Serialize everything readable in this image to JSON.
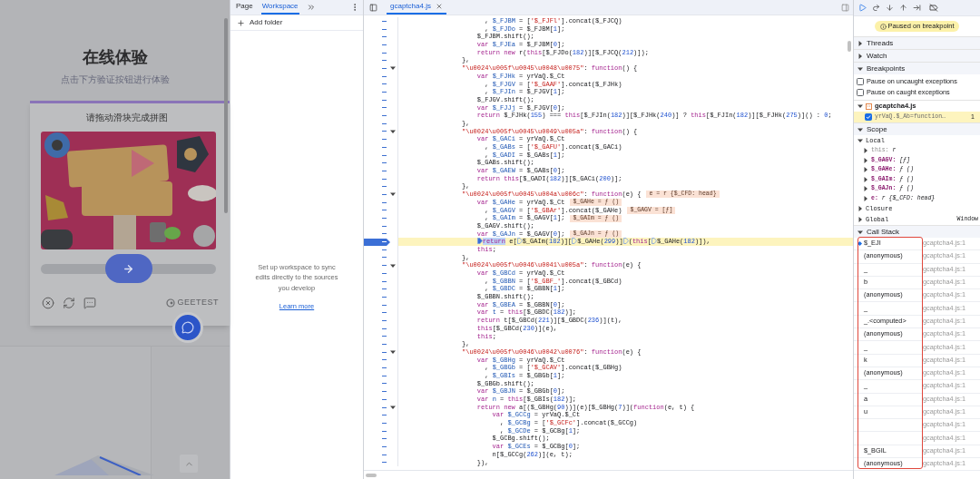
{
  "page": {
    "title": "在线体验",
    "subtitle": "点击下方验证按钮进行体验",
    "captcha": {
      "prompt": "请拖动滑块完成拼图",
      "slider": {
        "level": 0.5
      },
      "brand": "GEETEST"
    }
  },
  "navigator": {
    "tabs": [
      {
        "label": "Page",
        "selected": false
      },
      {
        "label": "Workspace",
        "selected": true
      }
    ],
    "add_folder": "Add folder",
    "message": "Set up workspace to sync edits directly to the sources you develop",
    "link": "Learn more"
  },
  "editor": {
    "tabs": [
      {
        "label": "gcaptcha4.js",
        "selected": true
      }
    ],
    "lines": [
      {
        "tokens": [
          {
            "kind": "p",
            "text": "      , "
          },
          {
            "kind": "d",
            "text": "$_FJBM"
          },
          {
            "kind": "p",
            "text": " = ["
          },
          {
            "kind": "s",
            "text": "'$_FJFl'"
          },
          {
            "kind": "p",
            "text": "].concat($_FJCQ)"
          }
        ]
      },
      {
        "tokens": [
          {
            "kind": "p",
            "text": "      , "
          },
          {
            "kind": "d",
            "text": "$_FJDo"
          },
          {
            "kind": "p",
            "text": " = $_FJBM["
          },
          {
            "kind": "n",
            "text": "1"
          },
          {
            "kind": "p",
            "text": "];"
          }
        ]
      },
      {
        "tokens": [
          {
            "kind": "p",
            "text": "    $_FJBM.shift();"
          }
        ]
      },
      {
        "tokens": [
          {
            "kind": "k",
            "text": "    var"
          },
          {
            "kind": "d",
            "text": " $_FJEa"
          },
          {
            "kind": "p",
            "text": " = $_FJBM["
          },
          {
            "kind": "n",
            "text": "0"
          },
          {
            "kind": "p",
            "text": "];"
          }
        ]
      },
      {
        "tokens": [
          {
            "kind": "k",
            "text": "    return new"
          },
          {
            "kind": "p",
            "text": " r("
          },
          {
            "kind": "k",
            "text": "this"
          },
          {
            "kind": "p",
            "text": "[$_FJDo("
          },
          {
            "kind": "n",
            "text": "182"
          },
          {
            "kind": "p",
            "text": ")][$_FJCQ("
          },
          {
            "kind": "n",
            "text": "212"
          },
          {
            "kind": "p",
            "text": ")]);"
          }
        ]
      },
      {
        "tokens": [
          {
            "kind": "p",
            "text": "},"
          }
        ]
      },
      {
        "expanded": true,
        "tokens": [
          {
            "kind": "s",
            "text": "\"\\u0024\\u005f\\u0045\\u0048\\u0075\""
          },
          {
            "kind": "p",
            "text": ": "
          },
          {
            "kind": "k",
            "text": "function"
          },
          {
            "kind": "p",
            "text": "() {"
          }
        ]
      },
      {
        "tokens": [
          {
            "kind": "k",
            "text": "    var"
          },
          {
            "kind": "d",
            "text": " $_FJHk"
          },
          {
            "kind": "p",
            "text": " = yrVaQ.$_Ct"
          }
        ]
      },
      {
        "tokens": [
          {
            "kind": "p",
            "text": "      , "
          },
          {
            "kind": "d",
            "text": "$_FJGV"
          },
          {
            "kind": "p",
            "text": " = ["
          },
          {
            "kind": "s",
            "text": "'$_GAAF'"
          },
          {
            "kind": "p",
            "text": "].concat($_FJHk)"
          }
        ]
      },
      {
        "tokens": [
          {
            "kind": "p",
            "text": "      , "
          },
          {
            "kind": "d",
            "text": "$_FJIn"
          },
          {
            "kind": "p",
            "text": " = $_FJGV["
          },
          {
            "kind": "n",
            "text": "1"
          },
          {
            "kind": "p",
            "text": "];"
          }
        ]
      },
      {
        "tokens": [
          {
            "kind": "p",
            "text": "    $_FJGV.shift();"
          }
        ]
      },
      {
        "tokens": [
          {
            "kind": "k",
            "text": "    var"
          },
          {
            "kind": "d",
            "text": " $_FJJj"
          },
          {
            "kind": "p",
            "text": " = $_FJGV["
          },
          {
            "kind": "n",
            "text": "0"
          },
          {
            "kind": "p",
            "text": "];"
          }
        ]
      },
      {
        "tokens": [
          {
            "kind": "k",
            "text": "    return"
          },
          {
            "kind": "p",
            "text": " $_FJHk("
          },
          {
            "kind": "n",
            "text": "155"
          },
          {
            "kind": "p",
            "text": ") === "
          },
          {
            "kind": "k",
            "text": "this"
          },
          {
            "kind": "p",
            "text": "[$_FJIn("
          },
          {
            "kind": "n",
            "text": "182"
          },
          {
            "kind": "p",
            "text": ")][$_FJHk("
          },
          {
            "kind": "n",
            "text": "240"
          },
          {
            "kind": "p",
            "text": ")] ? "
          },
          {
            "kind": "k",
            "text": "this"
          },
          {
            "kind": "p",
            "text": "[$_FJIn("
          },
          {
            "kind": "n",
            "text": "182"
          },
          {
            "kind": "p",
            "text": ")][$_FJHk("
          },
          {
            "kind": "n",
            "text": "275"
          },
          {
            "kind": "p",
            "text": ")]() : "
          },
          {
            "kind": "n",
            "text": "0"
          },
          {
            "kind": "p",
            "text": ";"
          }
        ]
      },
      {
        "tokens": [
          {
            "kind": "p",
            "text": "},"
          }
        ]
      },
      {
        "expanded": true,
        "tokens": [
          {
            "kind": "s",
            "text": "\"\\u0024\\u005f\\u0045\\u0049\\u005a\""
          },
          {
            "kind": "p",
            "text": ": "
          },
          {
            "kind": "k",
            "text": "function"
          },
          {
            "kind": "p",
            "text": "() {"
          }
        ]
      },
      {
        "tokens": [
          {
            "kind": "k",
            "text": "    var"
          },
          {
            "kind": "d",
            "text": " $_GACi"
          },
          {
            "kind": "p",
            "text": " = yrVaQ.$_Ct"
          }
        ]
      },
      {
        "tokens": [
          {
            "kind": "p",
            "text": "      , "
          },
          {
            "kind": "d",
            "text": "$_GABs"
          },
          {
            "kind": "p",
            "text": " = ["
          },
          {
            "kind": "s",
            "text": "'$_GAFU'"
          },
          {
            "kind": "p",
            "text": "].concat($_GACi)"
          }
        ]
      },
      {
        "tokens": [
          {
            "kind": "p",
            "text": "      , "
          },
          {
            "kind": "d",
            "text": "$_GADI"
          },
          {
            "kind": "p",
            "text": " = $_GABs["
          },
          {
            "kind": "n",
            "text": "1"
          },
          {
            "kind": "p",
            "text": "];"
          }
        ]
      },
      {
        "tokens": [
          {
            "kind": "p",
            "text": "    $_GABs.shift();"
          }
        ]
      },
      {
        "tokens": [
          {
            "kind": "k",
            "text": "    var"
          },
          {
            "kind": "d",
            "text": " $_GAEW"
          },
          {
            "kind": "p",
            "text": " = $_GABs["
          },
          {
            "kind": "n",
            "text": "0"
          },
          {
            "kind": "p",
            "text": "];"
          }
        ]
      },
      {
        "tokens": [
          {
            "kind": "k",
            "text": "    return this"
          },
          {
            "kind": "p",
            "text": "[$_GADI("
          },
          {
            "kind": "n",
            "text": "182"
          },
          {
            "kind": "p",
            "text": ")][$_GACi("
          },
          {
            "kind": "n",
            "text": "200"
          },
          {
            "kind": "p",
            "text": ")];"
          }
        ]
      },
      {
        "tokens": [
          {
            "kind": "p",
            "text": "},"
          }
        ]
      },
      {
        "expanded": true,
        "inline": "e = r {$_CFD: head}",
        "tokens": [
          {
            "kind": "s",
            "text": "\"\\u0024\\u005f\\u0045\\u004a\\u006c\""
          },
          {
            "kind": "p",
            "text": ": "
          },
          {
            "kind": "k",
            "text": "function"
          },
          {
            "kind": "p",
            "text": "(e) {"
          }
        ]
      },
      {
        "inline": "$_GAHe = ƒ ()",
        "tokens": [
          {
            "kind": "k",
            "text": "    var"
          },
          {
            "kind": "d",
            "text": " $_GAHe"
          },
          {
            "kind": "p",
            "text": " = yrVaQ.$_Ct"
          }
        ]
      },
      {
        "inline": "$_GAGV = [ƒ]",
        "tokens": [
          {
            "kind": "p",
            "text": "      , "
          },
          {
            "kind": "d",
            "text": "$_GAGV"
          },
          {
            "kind": "p",
            "text": " = ["
          },
          {
            "kind": "s",
            "text": "'$_GBAr'"
          },
          {
            "kind": "p",
            "text": "].concat($_GAHe)"
          }
        ]
      },
      {
        "inline": "$_GAIm = ƒ ()",
        "tokens": [
          {
            "kind": "p",
            "text": "      , "
          },
          {
            "kind": "d",
            "text": "$_GAIm"
          },
          {
            "kind": "p",
            "text": " = $_GAGV["
          },
          {
            "kind": "n",
            "text": "1"
          },
          {
            "kind": "p",
            "text": "];"
          }
        ]
      },
      {
        "tokens": [
          {
            "kind": "p",
            "text": "    $_GAGV.shift();"
          }
        ]
      },
      {
        "inline": "$_GAJn = ƒ ()",
        "tokens": [
          {
            "kind": "k",
            "text": "    var"
          },
          {
            "kind": "d",
            "text": " $_GAJn"
          },
          {
            "kind": "p",
            "text": " = $_GAGV["
          },
          {
            "kind": "n",
            "text": "0"
          },
          {
            "kind": "p",
            "text": "];"
          }
        ]
      },
      {
        "paused": true,
        "tokens": [
          {
            "kind": "c",
            "text": "    return"
          },
          {
            "kind": "p",
            "text": " e["
          },
          {
            "kind": "step"
          },
          {
            "kind": "p",
            "text": "$_GAIm("
          },
          {
            "kind": "n",
            "text": "182"
          },
          {
            "kind": "p",
            "text": ")]["
          },
          {
            "kind": "step"
          },
          {
            "kind": "p",
            "text": "$_GAHe("
          },
          {
            "kind": "n",
            "text": "299"
          },
          {
            "kind": "p",
            "text": ")]"
          },
          {
            "kind": "step"
          },
          {
            "kind": "p",
            "text": "("
          },
          {
            "kind": "k",
            "text": "this"
          },
          {
            "kind": "p",
            "text": "["
          },
          {
            "kind": "step"
          },
          {
            "kind": "p",
            "text": "$_GAHe("
          },
          {
            "kind": "n",
            "text": "182"
          },
          {
            "kind": "p",
            "text": ")]),"
          }
        ]
      },
      {
        "tokens": [
          {
            "kind": "k",
            "text": "    this"
          },
          {
            "kind": "p",
            "text": ";"
          }
        ]
      },
      {
        "tokens": [
          {
            "kind": "p",
            "text": "},"
          }
        ]
      },
      {
        "expanded": true,
        "tokens": [
          {
            "kind": "s",
            "text": "\"\\u0024\\u005f\\u0046\\u0041\\u005a\""
          },
          {
            "kind": "p",
            "text": ": "
          },
          {
            "kind": "k",
            "text": "function"
          },
          {
            "kind": "p",
            "text": "(e) {"
          }
        ]
      },
      {
        "tokens": [
          {
            "kind": "k",
            "text": "    var"
          },
          {
            "kind": "d",
            "text": " $_GBCd"
          },
          {
            "kind": "p",
            "text": " = yrVaQ.$_Ct"
          }
        ]
      },
      {
        "tokens": [
          {
            "kind": "p",
            "text": "      , "
          },
          {
            "kind": "d",
            "text": "$_GBBN"
          },
          {
            "kind": "p",
            "text": " = ["
          },
          {
            "kind": "s",
            "text": "'$_GBF_'"
          },
          {
            "kind": "p",
            "text": "].concat($_GBCd)"
          }
        ]
      },
      {
        "tokens": [
          {
            "kind": "p",
            "text": "      , "
          },
          {
            "kind": "d",
            "text": "$_GBDC"
          },
          {
            "kind": "p",
            "text": " = $_GBBN["
          },
          {
            "kind": "n",
            "text": "1"
          },
          {
            "kind": "p",
            "text": "];"
          }
        ]
      },
      {
        "tokens": [
          {
            "kind": "p",
            "text": "    $_GBBN.shift();"
          }
        ]
      },
      {
        "tokens": [
          {
            "kind": "k",
            "text": "    var"
          },
          {
            "kind": "d",
            "text": " $_GBEA"
          },
          {
            "kind": "p",
            "text": " = $_GBBN["
          },
          {
            "kind": "n",
            "text": "0"
          },
          {
            "kind": "p",
            "text": "];"
          }
        ]
      },
      {
        "tokens": [
          {
            "kind": "k",
            "text": "    var"
          },
          {
            "kind": "d",
            "text": " t"
          },
          {
            "kind": "p",
            "text": " = "
          },
          {
            "kind": "k",
            "text": "this"
          },
          {
            "kind": "p",
            "text": "[$_GBDC("
          },
          {
            "kind": "n",
            "text": "182"
          },
          {
            "kind": "p",
            "text": ")];"
          }
        ]
      },
      {
        "tokens": [
          {
            "kind": "k",
            "text": "    return"
          },
          {
            "kind": "p",
            "text": " t[$_GBCd("
          },
          {
            "kind": "n",
            "text": "221"
          },
          {
            "kind": "p",
            "text": ")][$_GBDC("
          },
          {
            "kind": "n",
            "text": "236"
          },
          {
            "kind": "p",
            "text": ")](t),"
          }
        ]
      },
      {
        "tokens": [
          {
            "kind": "k",
            "text": "    this"
          },
          {
            "kind": "p",
            "text": "[$_GBCd("
          },
          {
            "kind": "n",
            "text": "230"
          },
          {
            "kind": "p",
            "text": ")](e),"
          }
        ]
      },
      {
        "tokens": [
          {
            "kind": "k",
            "text": "    this"
          },
          {
            "kind": "p",
            "text": ";"
          }
        ]
      },
      {
        "tokens": [
          {
            "kind": "p",
            "text": "},"
          }
        ]
      },
      {
        "expanded": true,
        "tokens": [
          {
            "kind": "s",
            "text": "\"\\u0024\\u005f\\u0046\\u0042\\u0076\""
          },
          {
            "kind": "p",
            "text": ": "
          },
          {
            "kind": "k",
            "text": "function"
          },
          {
            "kind": "p",
            "text": "(e) {"
          }
        ]
      },
      {
        "tokens": [
          {
            "kind": "k",
            "text": "    var"
          },
          {
            "kind": "d",
            "text": " $_GBHg"
          },
          {
            "kind": "p",
            "text": " = yrVaQ.$_Ct"
          }
        ]
      },
      {
        "tokens": [
          {
            "kind": "p",
            "text": "      , "
          },
          {
            "kind": "d",
            "text": "$_GBGb"
          },
          {
            "kind": "p",
            "text": " = ["
          },
          {
            "kind": "s",
            "text": "'$_GCAV'"
          },
          {
            "kind": "p",
            "text": "].concat($_GBHg)"
          }
        ]
      },
      {
        "tokens": [
          {
            "kind": "p",
            "text": "      , "
          },
          {
            "kind": "d",
            "text": "$_GBIs"
          },
          {
            "kind": "p",
            "text": " = $_GBGb["
          },
          {
            "kind": "n",
            "text": "1"
          },
          {
            "kind": "p",
            "text": "];"
          }
        ]
      },
      {
        "tokens": [
          {
            "kind": "p",
            "text": "    $_GBGb.shift();"
          }
        ]
      },
      {
        "tokens": [
          {
            "kind": "k",
            "text": "    var"
          },
          {
            "kind": "d",
            "text": " $_GBJN"
          },
          {
            "kind": "p",
            "text": " = $_GBGb["
          },
          {
            "kind": "n",
            "text": "0"
          },
          {
            "kind": "p",
            "text": "];"
          }
        ]
      },
      {
        "tokens": [
          {
            "kind": "k",
            "text": "    var"
          },
          {
            "kind": "d",
            "text": " n"
          },
          {
            "kind": "p",
            "text": " = "
          },
          {
            "kind": "k",
            "text": "this"
          },
          {
            "kind": "p",
            "text": "[$_GBIs("
          },
          {
            "kind": "n",
            "text": "182"
          },
          {
            "kind": "p",
            "text": ")];"
          }
        ]
      },
      {
        "expanded": true,
        "tokens": [
          {
            "kind": "k",
            "text": "    return new"
          },
          {
            "kind": "p",
            "text": " a[($_GBHg("
          },
          {
            "kind": "n",
            "text": "90"
          },
          {
            "kind": "p",
            "text": "))](e)[$_GBHg("
          },
          {
            "kind": "n",
            "text": "7"
          },
          {
            "kind": "p",
            "text": ")]("
          },
          {
            "kind": "k",
            "text": "function"
          },
          {
            "kind": "p",
            "text": "(e, t) {"
          }
        ]
      },
      {
        "tokens": [
          {
            "kind": "k",
            "text": "        var"
          },
          {
            "kind": "d",
            "text": " $_GCCg"
          },
          {
            "kind": "p",
            "text": " = yrVaQ.$_Ct"
          }
        ]
      },
      {
        "tokens": [
          {
            "kind": "p",
            "text": "          , "
          },
          {
            "kind": "d",
            "text": "$_GCBg"
          },
          {
            "kind": "p",
            "text": " = ["
          },
          {
            "kind": "s",
            "text": "'$_GCFc'"
          },
          {
            "kind": "p",
            "text": "].concat($_GCCg)"
          }
        ]
      },
      {
        "tokens": [
          {
            "kind": "p",
            "text": "          , "
          },
          {
            "kind": "d",
            "text": "$_GCDe"
          },
          {
            "kind": "p",
            "text": " = $_GCBg["
          },
          {
            "kind": "n",
            "text": "1"
          },
          {
            "kind": "p",
            "text": "];"
          }
        ]
      },
      {
        "tokens": [
          {
            "kind": "p",
            "text": "        $_GCBg.shift();"
          }
        ]
      },
      {
        "tokens": [
          {
            "kind": "k",
            "text": "        var"
          },
          {
            "kind": "d",
            "text": " $_GCEs"
          },
          {
            "kind": "p",
            "text": " = $_GCBg["
          },
          {
            "kind": "n",
            "text": "0"
          },
          {
            "kind": "p",
            "text": "];"
          }
        ]
      },
      {
        "tokens": [
          {
            "kind": "p",
            "text": "        n[$_GCCg("
          },
          {
            "kind": "n",
            "text": "262"
          },
          {
            "kind": "p",
            "text": ")](e, t);"
          }
        ]
      },
      {
        "tokens": [
          {
            "kind": "p",
            "text": "    }),"
          }
        ]
      }
    ]
  },
  "debugger": {
    "status": "Paused on breakpoint",
    "threads": {
      "label": "Threads",
      "expanded": false
    },
    "watch": {
      "label": "Watch",
      "expanded": false
    },
    "breakpoints": {
      "label": "Breakpoints",
      "expanded": true,
      "options": [
        {
          "label": "Pause on uncaught exceptions",
          "checked": false
        },
        {
          "label": "Pause on caught exceptions",
          "checked": false
        }
      ],
      "files": [
        {
          "name": "gcaptcha4.js",
          "expanded": true,
          "items": [
            {
              "label": "yrVaQ.$_Ab=function…",
              "count": "1",
              "checked": true,
              "active": true
            }
          ]
        }
      ]
    },
    "scope": {
      "label": "Scope",
      "expanded": true,
      "groups": [
        {
          "label": "Local",
          "expanded": true,
          "items": [
            {
              "kind": "this",
              "name": "this:",
              "value": "r"
            },
            {
              "kind": "var",
              "name": "$_GAGV:",
              "value": "[ƒ]"
            },
            {
              "kind": "var",
              "name": "$_GAHe:",
              "value": "ƒ ()"
            },
            {
              "kind": "var",
              "name": "$_GAIm:",
              "value": "ƒ ()"
            },
            {
              "kind": "var",
              "name": "$_GAJn:",
              "value": "ƒ ()"
            },
            {
              "kind": "var",
              "name": "e:",
              "value": "r {$_CFD: head}"
            }
          ]
        },
        {
          "label": "Closure",
          "expanded": false
        },
        {
          "label": "Global",
          "expanded": false,
          "value": "Window"
        }
      ]
    },
    "call_stack": {
      "label": "Call Stack",
      "expanded": true,
      "frames": [
        {
          "name": "$_EJI",
          "file": "gcaptcha4.js:1",
          "selected": true
        },
        {
          "name": "(anonymous)",
          "file": "gcaptcha4.js:1",
          "selected": false
        },
        {
          "name": "_",
          "file": "gcaptcha4.js:1",
          "selected": false
        },
        {
          "name": "b",
          "file": "gcaptcha4.js:1",
          "selected": false
        },
        {
          "name": "(anonymous)",
          "file": "gcaptcha4.js:1",
          "selected": false
        },
        {
          "name": "_",
          "file": "gcaptcha4.js:1",
          "selected": false
        },
        {
          "name": "_.<computed>",
          "file": "gcaptcha4.js:1",
          "selected": false
        },
        {
          "name": "(anonymous)",
          "file": "gcaptcha4.js:1",
          "selected": false
        },
        {
          "name": "_",
          "file": "gcaptcha4.js:1",
          "selected": false
        },
        {
          "name": "k",
          "file": "gcaptcha4.js:1",
          "selected": false
        },
        {
          "name": "(anonymous)",
          "file": "gcaptcha4.js:1",
          "selected": false
        },
        {
          "name": "_",
          "file": "gcaptcha4.js:1",
          "selected": false
        },
        {
          "name": "a",
          "file": "gcaptcha4.js:1",
          "selected": false
        },
        {
          "name": "u",
          "file": "gcaptcha4.js:1",
          "selected": false
        },
        {
          "file": "gcaptcha4.js:1",
          "selected": false
        },
        {
          "file": "gcaptcha4.js:1",
          "selected": false
        },
        {
          "name": "$_BGIL",
          "file": "gcaptcha4.js:1",
          "selected": false
        },
        {
          "name": "(anonymous)",
          "file": "gcaptcha4.js:1",
          "selected": false
        }
      ]
    }
  }
}
